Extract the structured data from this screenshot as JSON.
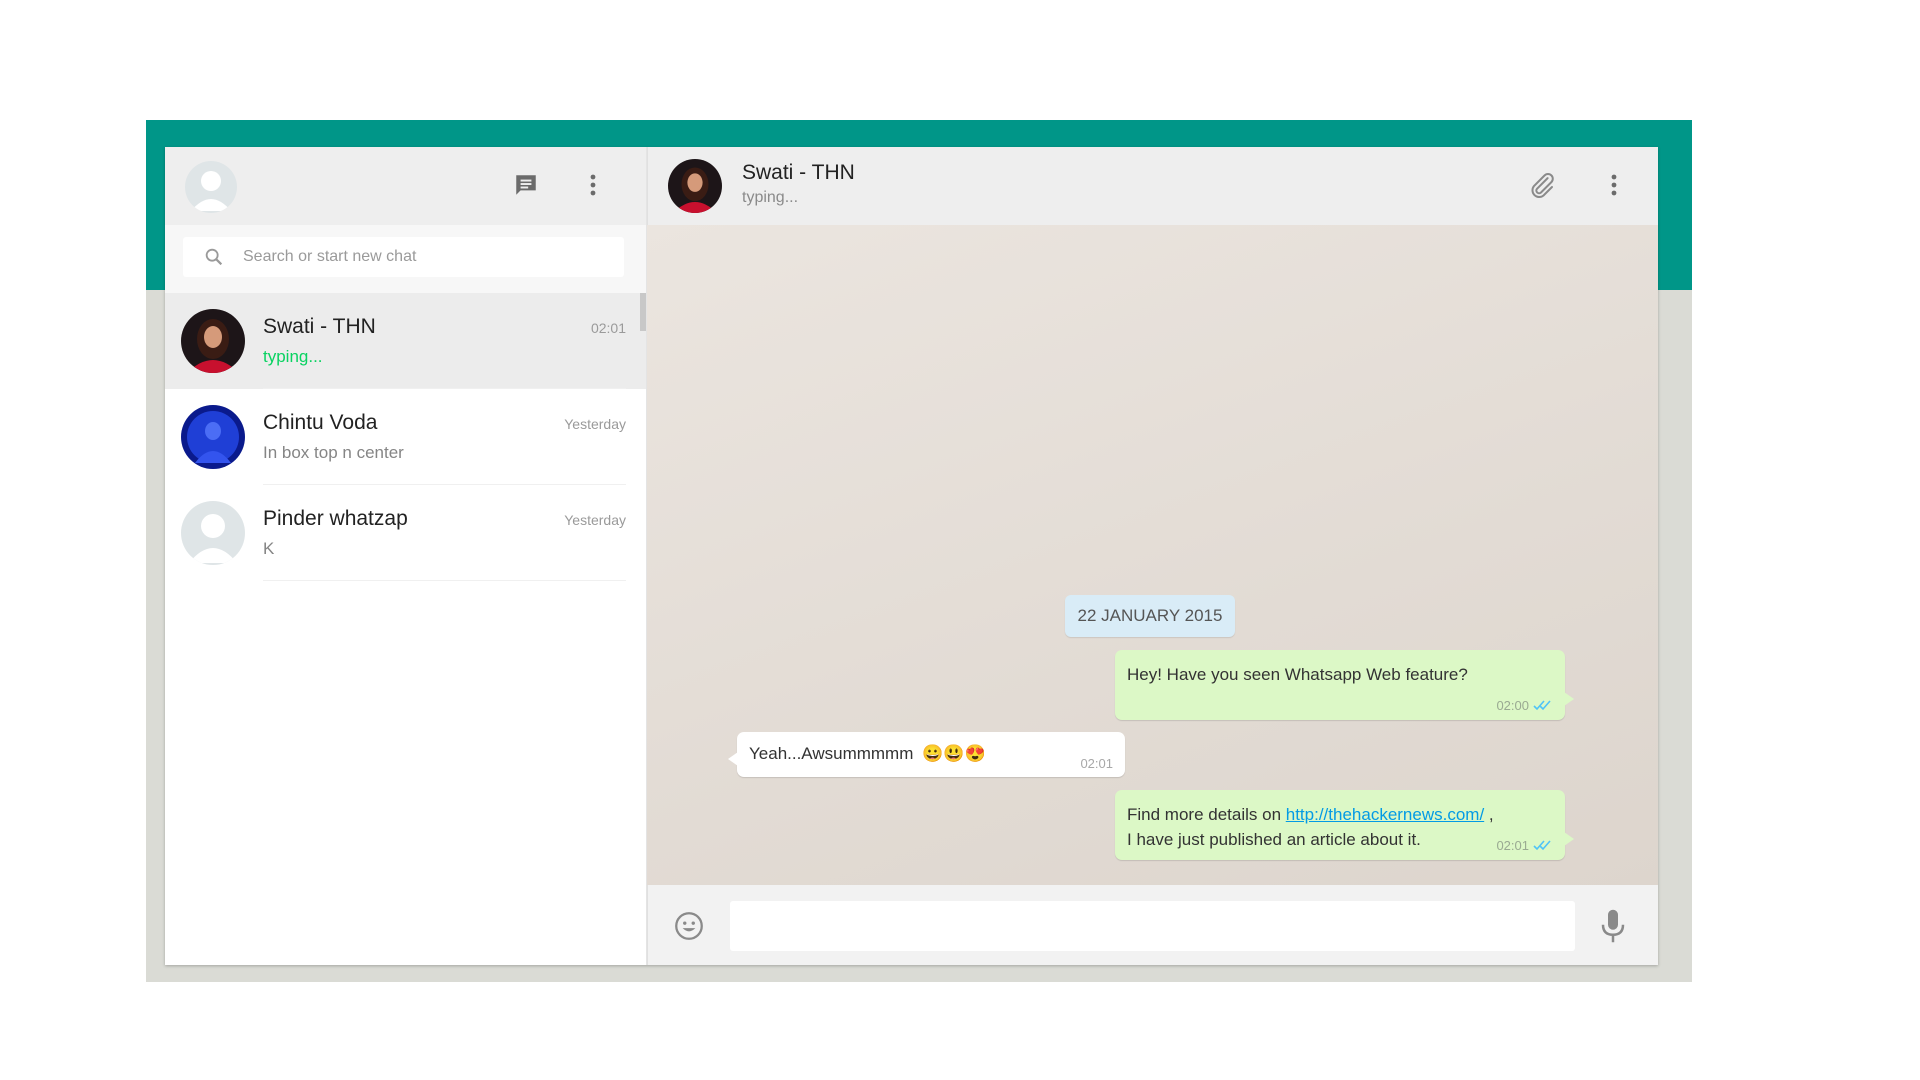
{
  "sidebar": {
    "search": {
      "placeholder": "Search or start new chat",
      "value": ""
    },
    "chats": [
      {
        "name": "Swati - THN",
        "time": "02:01",
        "preview": "typing...",
        "active": true
      },
      {
        "name": "Chintu Voda",
        "time": "Yesterday",
        "preview": "In box top n center",
        "active": false
      },
      {
        "name": "Pinder whatzap",
        "time": "Yesterday",
        "preview": "K",
        "active": false
      }
    ]
  },
  "conversation": {
    "contact_name": "Swati - THN",
    "contact_status": "typing...",
    "date_divider": "22 JANUARY 2015",
    "messages": [
      {
        "direction": "out",
        "text": "Hey! Have you seen Whatsapp Web feature?",
        "time": "02:00"
      },
      {
        "direction": "in",
        "text": "Yeah...Awsummmmm",
        "emoji": "😀😃😍",
        "time": "02:01"
      },
      {
        "direction": "out",
        "text_before": "Find more details on ",
        "link": "http://thehackernews.com/",
        "text_after": " ,",
        "line2": "I have just published an article about it.",
        "time": "02:01"
      }
    ],
    "compose": {
      "placeholder": "",
      "value": ""
    }
  },
  "colors": {
    "brand": "#009688",
    "outgoing_bubble": "#dcf8c6",
    "typing": "#09d261",
    "link": "#039be5",
    "read_ticks": "#4fc3f7"
  },
  "icons": [
    "default-avatar-icon",
    "new-chat-icon",
    "menu-dots-icon",
    "search-icon",
    "attach-icon",
    "emoji-icon",
    "mic-icon",
    "double-check-icon"
  ]
}
